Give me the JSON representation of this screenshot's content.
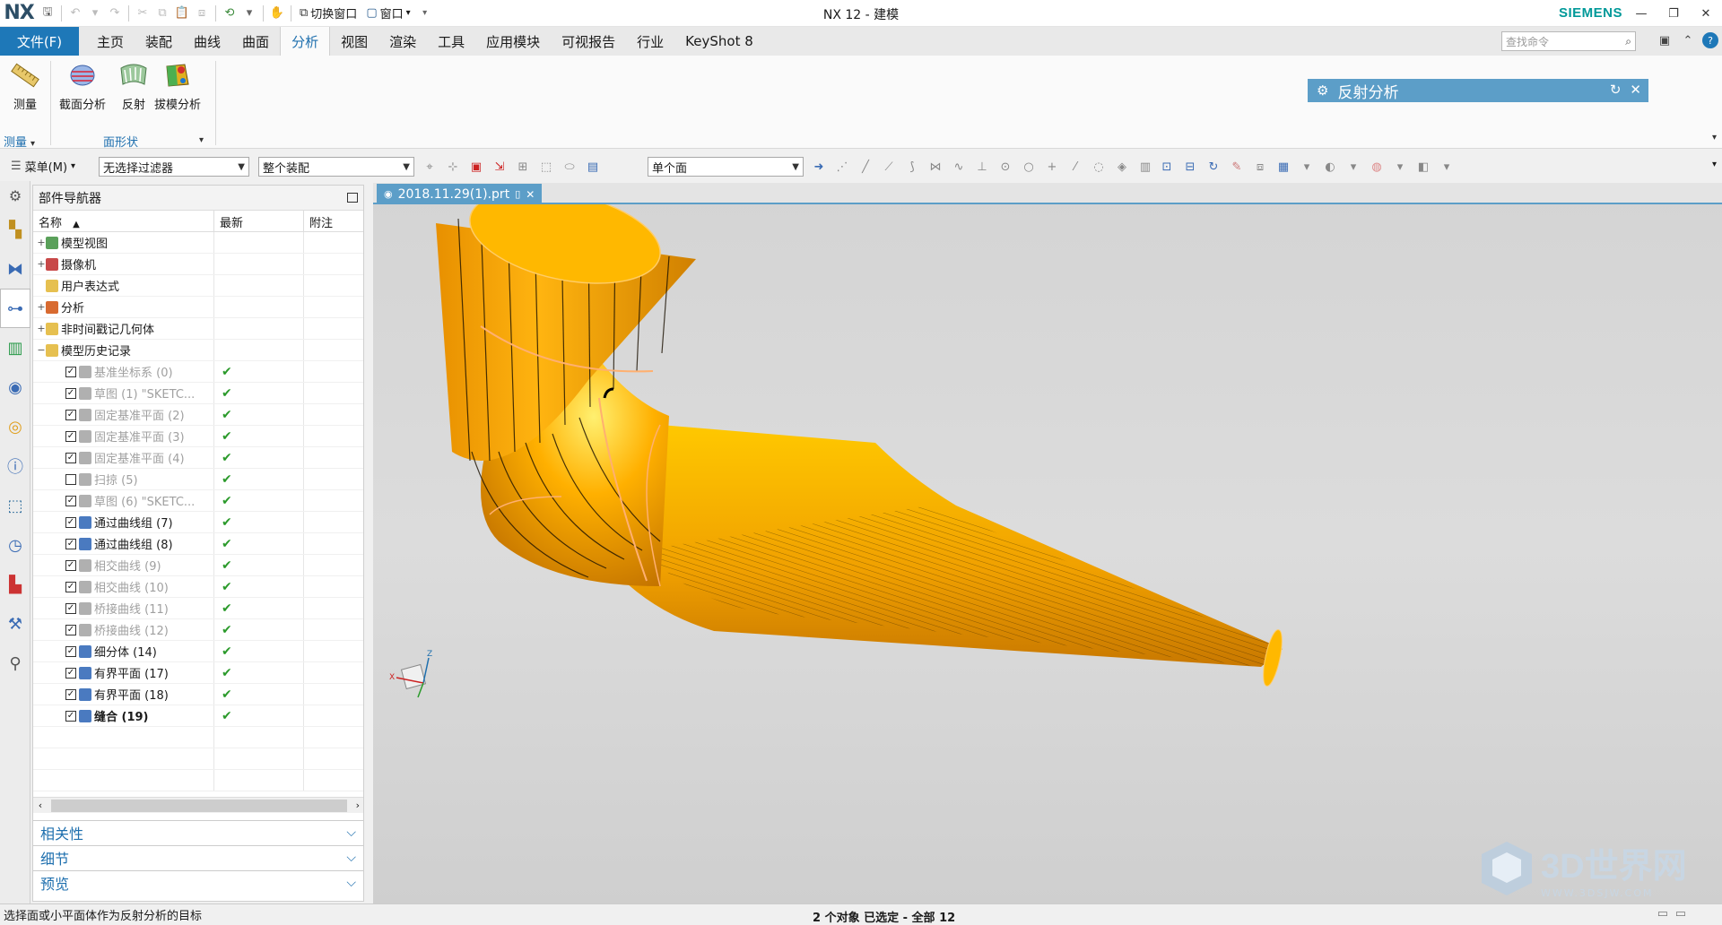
{
  "titlebar": {
    "logo": "NX",
    "switch_window": "切换窗口",
    "window": "窗口",
    "title": "NX 12 - 建模",
    "brand": "SIEMENS"
  },
  "menu": {
    "file": "文件(F)",
    "tabs": [
      "主页",
      "装配",
      "曲线",
      "曲面",
      "分析",
      "视图",
      "渲染",
      "工具",
      "应用模块",
      "可视报告",
      "行业",
      "KeyShot 8"
    ],
    "active_tab": "分析",
    "search_placeholder": "查找命令"
  },
  "ribbon": {
    "buttons": {
      "measure": "测量",
      "section": "截面分析",
      "reflection": "反射",
      "draft": "拔模分析"
    },
    "groups": {
      "measure": "测量",
      "face_shape": "面形状"
    },
    "dialog_title": "反射分析"
  },
  "toolbar": {
    "menu": "菜单(M)",
    "filter": "无选择过滤器",
    "scope": "整个装配",
    "face_rule": "单个面"
  },
  "navigator": {
    "title": "部件导航器",
    "columns": [
      "名称",
      "最新",
      "附注"
    ],
    "top_items": [
      {
        "label": "模型视图",
        "expand": "+"
      },
      {
        "label": "摄像机",
        "expand": "+"
      },
      {
        "label": "用户表达式",
        "expand": ""
      },
      {
        "label": "分析",
        "expand": "+"
      },
      {
        "label": "非时间戳记几何体",
        "expand": "+"
      },
      {
        "label": "模型历史记录",
        "expand": "−"
      }
    ],
    "history": [
      {
        "label": "基准坐标系 (0)",
        "checked": true,
        "grey": true,
        "bold": false
      },
      {
        "label": "草图 (1) \"SKETC...",
        "checked": true,
        "grey": true,
        "bold": false
      },
      {
        "label": "固定基准平面 (2)",
        "checked": true,
        "grey": true,
        "bold": false
      },
      {
        "label": "固定基准平面 (3)",
        "checked": true,
        "grey": true,
        "bold": false
      },
      {
        "label": "固定基准平面 (4)",
        "checked": true,
        "grey": true,
        "bold": false
      },
      {
        "label": "扫掠 (5)",
        "checked": false,
        "grey": true,
        "bold": false
      },
      {
        "label": "草图 (6) \"SKETC...",
        "checked": true,
        "grey": true,
        "bold": false
      },
      {
        "label": "通过曲线组 (7)",
        "checked": true,
        "grey": false,
        "bold": false
      },
      {
        "label": "通过曲线组 (8)",
        "checked": true,
        "grey": false,
        "bold": false
      },
      {
        "label": "相交曲线 (9)",
        "checked": true,
        "grey": true,
        "bold": false
      },
      {
        "label": "相交曲线 (10)",
        "checked": true,
        "grey": true,
        "bold": false
      },
      {
        "label": "桥接曲线 (11)",
        "checked": true,
        "grey": true,
        "bold": false
      },
      {
        "label": "桥接曲线 (12)",
        "checked": true,
        "grey": true,
        "bold": false
      },
      {
        "label": "细分体 (14)",
        "checked": true,
        "grey": false,
        "bold": false
      },
      {
        "label": "有界平面 (17)",
        "checked": true,
        "grey": false,
        "bold": false
      },
      {
        "label": "有界平面 (18)",
        "checked": true,
        "grey": false,
        "bold": false
      },
      {
        "label": "缝合 (19)",
        "checked": true,
        "grey": false,
        "bold": true
      }
    ],
    "up_to_date_mark": "✔",
    "panels": [
      "相关性",
      "细节",
      "预览"
    ]
  },
  "graphics": {
    "tab_label": "2018.11.29(1).prt",
    "colors": {
      "surface": "#f0a500",
      "surface_light": "#ffc21a",
      "edge": "#ffb070",
      "background": "#d8d8d8"
    }
  },
  "status": {
    "prompt": "选择面或小平面体作为反射分析的目标",
    "selection": "2 个对象 已选定 - 全部 12"
  },
  "watermark": {
    "title": "3D世界网",
    "url": "WWW.3DSJW.COM"
  }
}
